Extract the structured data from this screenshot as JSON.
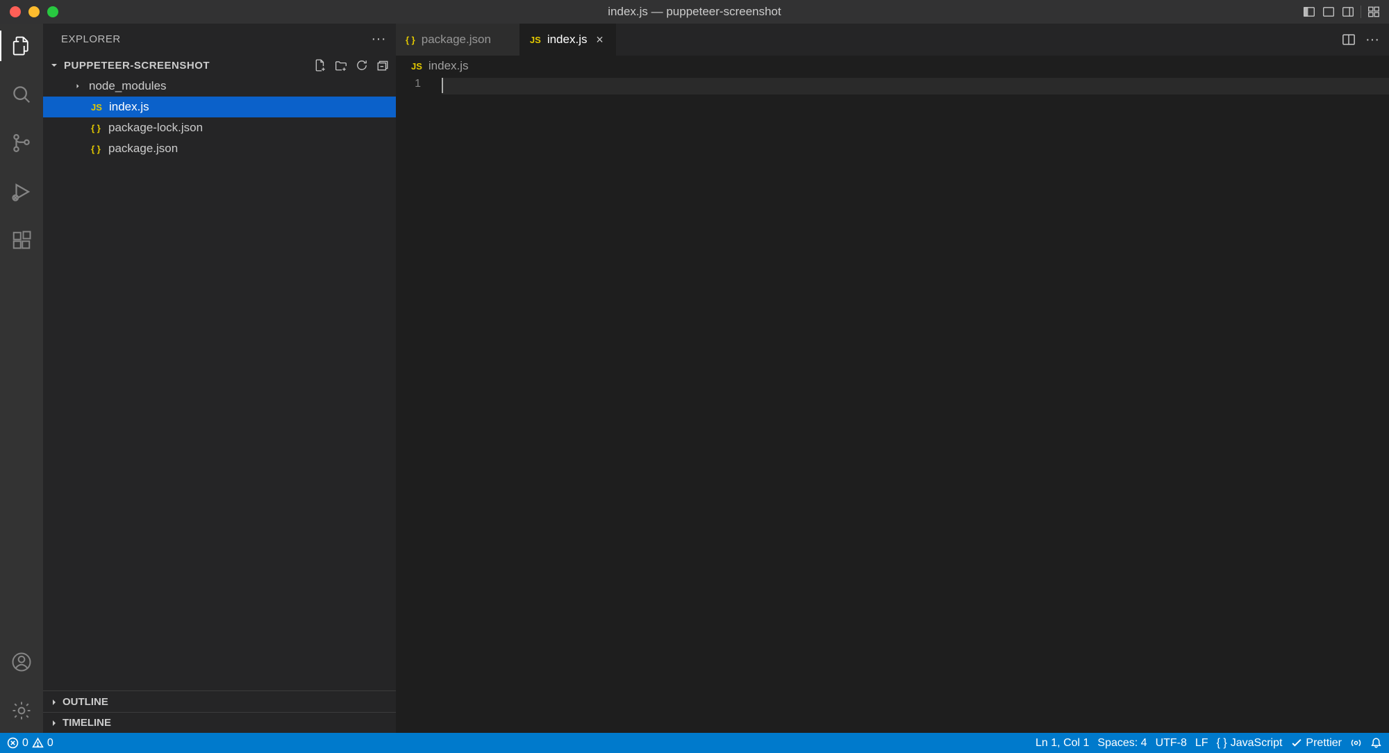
{
  "window": {
    "title": "index.js — puppeteer-screenshot"
  },
  "sidebar": {
    "title": "EXPLORER",
    "project": "PUPPETEER-SCREENSHOT",
    "items": [
      {
        "label": "node_modules",
        "type": "folder"
      },
      {
        "label": "index.js",
        "type": "js"
      },
      {
        "label": "package-lock.json",
        "type": "json"
      },
      {
        "label": "package.json",
        "type": "json"
      }
    ],
    "sections": {
      "outline": "OUTLINE",
      "timeline": "TIMELINE"
    }
  },
  "tabs": [
    {
      "label": "package.json",
      "type": "json",
      "active": false
    },
    {
      "label": "index.js",
      "type": "js",
      "active": true
    }
  ],
  "breadcrumb": {
    "label": "index.js"
  },
  "editor": {
    "line_number": "1"
  },
  "status": {
    "errors": "0",
    "warnings": "0",
    "position": "Ln 1, Col 1",
    "spaces": "Spaces: 4",
    "encoding": "UTF-8",
    "eol": "LF",
    "language": "JavaScript",
    "formatter": "Prettier"
  }
}
